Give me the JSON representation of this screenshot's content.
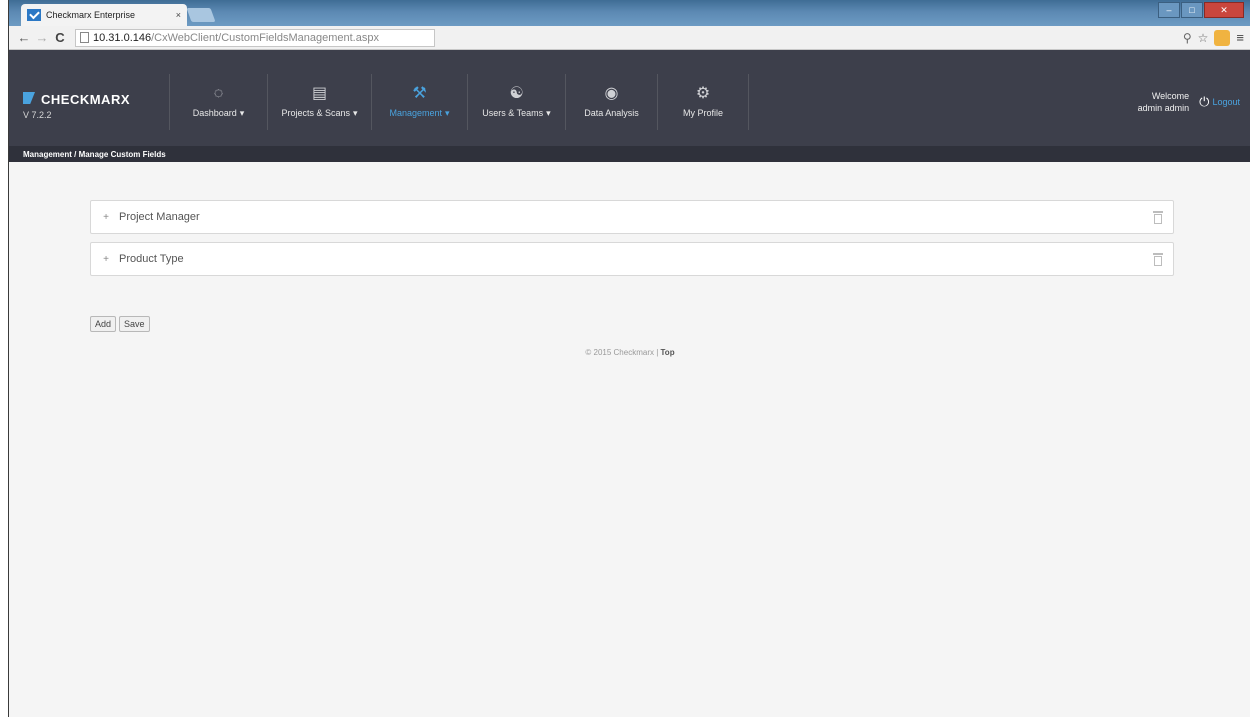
{
  "browser": {
    "tab_title": "Checkmarx Enterprise",
    "tab_close": "×",
    "url_host": "10.31.0.146",
    "url_path": "/CxWebClient/CustomFieldsManagement.aspx"
  },
  "brand": {
    "name": "CHECKMARX",
    "version": "V 7.2.2",
    "accent_color": "#4aa3df"
  },
  "nav": {
    "items": [
      {
        "label": "Dashboard",
        "icon": "gauge-icon",
        "dropdown": true
      },
      {
        "label": "Projects & Scans",
        "icon": "document-search-icon",
        "dropdown": true
      },
      {
        "label": "Management",
        "icon": "wrench-icon",
        "dropdown": true,
        "active": true
      },
      {
        "label": "Users & Teams",
        "icon": "users-icon",
        "dropdown": true
      },
      {
        "label": "Data Analysis",
        "icon": "magnifier-chart-icon",
        "dropdown": false
      },
      {
        "label": "My Profile",
        "icon": "profile-gear-icon",
        "dropdown": false
      }
    ],
    "caret": "▾"
  },
  "user": {
    "welcome": "Welcome",
    "name": "admin admin",
    "logout": "Logout"
  },
  "breadcrumb": "Management / Manage Custom Fields",
  "custom_fields": [
    {
      "name": "Project Manager"
    },
    {
      "name": "Product Type"
    }
  ],
  "buttons": {
    "add": "Add",
    "save": "Save"
  },
  "footer": {
    "copyright": "© 2015 Checkmarx |",
    "top_link": "Top"
  }
}
